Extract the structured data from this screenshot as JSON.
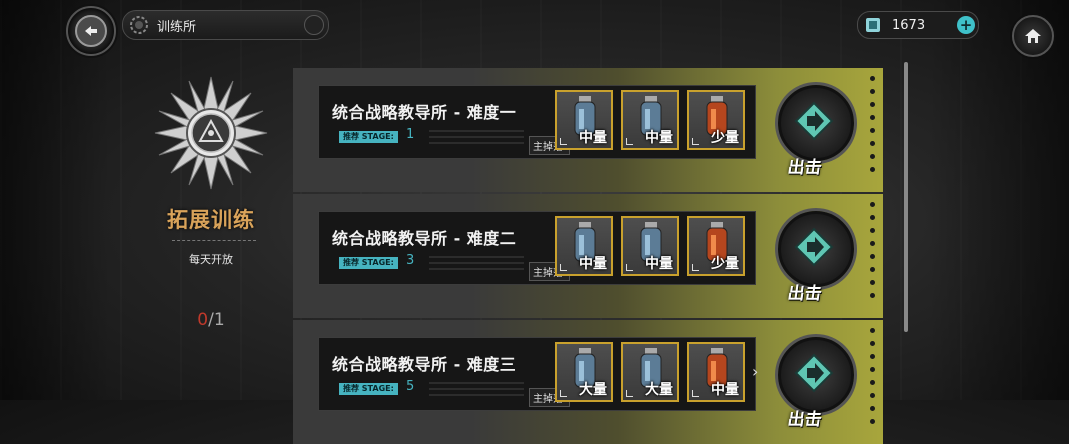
{
  "header": {
    "title": "训练所",
    "currency_value": "1673"
  },
  "left_panel": {
    "title": "拓展训练",
    "subtitle": "每天开放",
    "count_current": "0",
    "count_separator": "/",
    "count_total": "1"
  },
  "rows": [
    {
      "title": "统合战略教导所 - 难度一",
      "stage_label": "推荐 STAGE:",
      "stage_value": "1",
      "drop_label": "主掉落:",
      "items": [
        {
          "label": "中量",
          "icon": "blue-vial-icon"
        },
        {
          "label": "中量",
          "icon": "blue-vial-icon"
        },
        {
          "label": "少量",
          "icon": "orange-vial-icon"
        }
      ],
      "go_label": "出击"
    },
    {
      "title": "统合战略教导所 - 难度二",
      "stage_label": "推荐 STAGE:",
      "stage_value": "3",
      "drop_label": "主掉落:",
      "items": [
        {
          "label": "中量",
          "icon": "blue-vial-icon"
        },
        {
          "label": "中量",
          "icon": "blue-vial-icon"
        },
        {
          "label": "少量",
          "icon": "orange-vial-icon"
        }
      ],
      "go_label": "出击"
    },
    {
      "title": "统合战略教导所 - 难度三",
      "stage_label": "推荐 STAGE:",
      "stage_value": "5",
      "drop_label": "主掉落:",
      "items": [
        {
          "label": "大量",
          "icon": "blue-vial-icon"
        },
        {
          "label": "大量",
          "icon": "blue-vial-icon"
        },
        {
          "label": "中量",
          "icon": "orange-vial-icon"
        }
      ],
      "go_label": "出击"
    }
  ],
  "colors": {
    "accent_cyan": "#46b3c0",
    "accent_gold": "#c9a12d",
    "panel_title": "#d9a35a",
    "counter_red": "#c0392b"
  }
}
